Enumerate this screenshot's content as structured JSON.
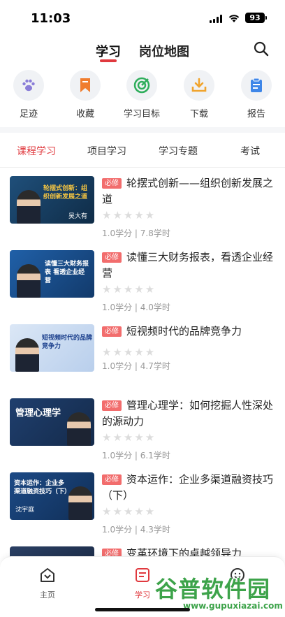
{
  "status_bar": {
    "time": "11:03",
    "battery": "93"
  },
  "header": {
    "tabs": [
      "学习",
      "岗位地图"
    ],
    "active_tab": 0,
    "accent_color": "#e0393e"
  },
  "quick_actions": [
    {
      "label": "足迹",
      "icon": "paw-icon",
      "color": "#8a7dd8"
    },
    {
      "label": "收藏",
      "icon": "bookmark-icon",
      "color": "#f07d2e"
    },
    {
      "label": "学习目标",
      "icon": "target-icon",
      "color": "#2fae5c"
    },
    {
      "label": "下载",
      "icon": "download-icon",
      "color": "#f0a42e"
    },
    {
      "label": "报告",
      "icon": "clipboard-icon",
      "color": "#3e86e8"
    }
  ],
  "course_tabs": [
    "课程学习",
    "项目学习",
    "学习专题",
    "考试"
  ],
  "active_course_tab": 0,
  "courses": [
    {
      "badge": "必修",
      "title": "轮摆式创新——组织创新发展之道",
      "rating": 0,
      "credit": "1.0学分",
      "hours": "7.8学时",
      "thumb_title": "轮摆式创新：组织创新发展之道",
      "thumb_name": "吴大有"
    },
    {
      "badge": "必修",
      "title": "读懂三大财务报表，看透企业经营",
      "rating": 0,
      "credit": "1.0学分",
      "hours": "4.0学时",
      "thumb_title": "读懂三大财务报表 看透企业经营",
      "thumb_name": ""
    },
    {
      "badge": "必修",
      "title": "短视频时代的品牌竞争力",
      "rating": 0,
      "credit": "1.0学分",
      "hours": "4.7学时",
      "thumb_title": "短视频时代的品牌竞争力",
      "thumb_name": ""
    },
    {
      "badge": "必修",
      "title": "管理心理学：如何挖掘人性深处的源动力",
      "rating": 0,
      "credit": "1.0学分",
      "hours": "6.1学时",
      "thumb_title": "管理心理学",
      "thumb_name": ""
    },
    {
      "badge": "必修",
      "title": "资本运作：企业多渠道融资技巧（下）",
      "rating": 0,
      "credit": "1.0学分",
      "hours": "4.3学时",
      "thumb_title": "资本运作：企业多渠道融资技巧（下）",
      "thumb_name": "沈宇庭"
    },
    {
      "badge": "必修",
      "title": "变革环境下的卓越领导力",
      "rating": 0,
      "credit": "",
      "hours": "",
      "thumb_title": "",
      "thumb_name": ""
    }
  ],
  "bottom_nav": [
    {
      "label": "主页",
      "icon": "home-icon"
    },
    {
      "label": "学习",
      "icon": "book-icon"
    },
    {
      "label": "",
      "icon": "smile-icon"
    }
  ],
  "active_nav": 1,
  "watermark": {
    "cn": "谷普软件园",
    "en": "www.gupuxiazai.com"
  }
}
